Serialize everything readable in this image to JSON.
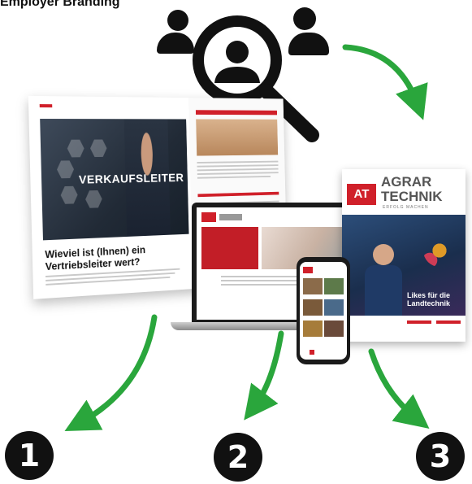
{
  "title": "Employer Branding",
  "spread": {
    "photo_label": "VERKAUFSLEITER",
    "headline": "Wieviel ist (Ihnen) ein Vertriebsleiter wert?"
  },
  "cover": {
    "logo": "AT",
    "brand_line1": "AGRAR",
    "brand_line2": "TECHNIK",
    "tagline": "ERFOLG MACHEN",
    "caption": "Likes für die Landtechnik"
  },
  "steps": [
    "1",
    "2",
    "3"
  ],
  "colors": {
    "arrow": "#2aa63c",
    "brand_red": "#d0202a",
    "badge": "#111111"
  },
  "icons": [
    "people-search-icon",
    "magnifier-icon"
  ]
}
